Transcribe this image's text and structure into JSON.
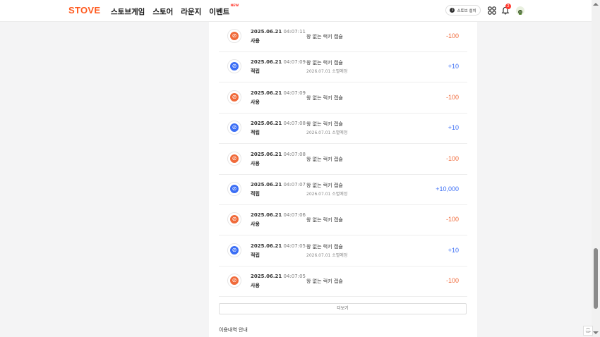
{
  "header": {
    "logo": "STOVE",
    "nav": [
      "스토브게임",
      "스토어",
      "라운지",
      "이벤트"
    ],
    "new_badge": "NEW",
    "install_label": "스토브 설치",
    "bell_count": "2"
  },
  "history": [
    {
      "date": "2025.06.21",
      "time": "04:07:11",
      "type": "사용",
      "item": "왕 없는 럭키 캡슐",
      "expire": "",
      "amount": "-100",
      "kind": "use"
    },
    {
      "date": "2025.06.21",
      "time": "04:07:09",
      "type": "적립",
      "item": "왕 없는 럭키 캡슐",
      "expire": "2026.07.01 소멸예정",
      "amount": "+10",
      "kind": "earn"
    },
    {
      "date": "2025.06.21",
      "time": "04:07:09",
      "type": "사용",
      "item": "왕 없는 럭키 캡슐",
      "expire": "",
      "amount": "-100",
      "kind": "use"
    },
    {
      "date": "2025.06.21",
      "time": "04:07:08",
      "type": "적립",
      "item": "왕 없는 럭키 캡슐",
      "expire": "2026.07.01 소멸예정",
      "amount": "+10",
      "kind": "earn"
    },
    {
      "date": "2025.06.21",
      "time": "04:07:08",
      "type": "사용",
      "item": "왕 없는 럭키 캡슐",
      "expire": "",
      "amount": "-100",
      "kind": "use"
    },
    {
      "date": "2025.06.21",
      "time": "04:07:07",
      "type": "적립",
      "item": "왕 없는 럭키 캡슐",
      "expire": "2026.07.01 소멸예정",
      "amount": "+10,000",
      "kind": "earn"
    },
    {
      "date": "2025.06.21",
      "time": "04:07:06",
      "type": "사용",
      "item": "왕 없는 럭키 캡슐",
      "expire": "",
      "amount": "-100",
      "kind": "use"
    },
    {
      "date": "2025.06.21",
      "time": "04:07:05",
      "type": "적립",
      "item": "왕 없는 럭키 캡슐",
      "expire": "2026.07.01 소멸예정",
      "amount": "+10",
      "kind": "earn"
    },
    {
      "date": "2025.06.21",
      "time": "04:07:05",
      "type": "사용",
      "item": "왕 없는 럭키 캡슐",
      "expire": "",
      "amount": "-100",
      "kind": "use"
    }
  ],
  "more_label": "더보기",
  "notice_title": "이용내역 안내",
  "top_label": "TOP",
  "colors": {
    "brand": "#ff5a1f",
    "use": "#f06a3a",
    "earn": "#3b6ef5"
  },
  "icons": {
    "use": "capsule-use-icon",
    "earn": "capsule-earn-icon",
    "bell": "bell-icon",
    "apps": "apps-grid-icon",
    "download": "download-icon"
  }
}
